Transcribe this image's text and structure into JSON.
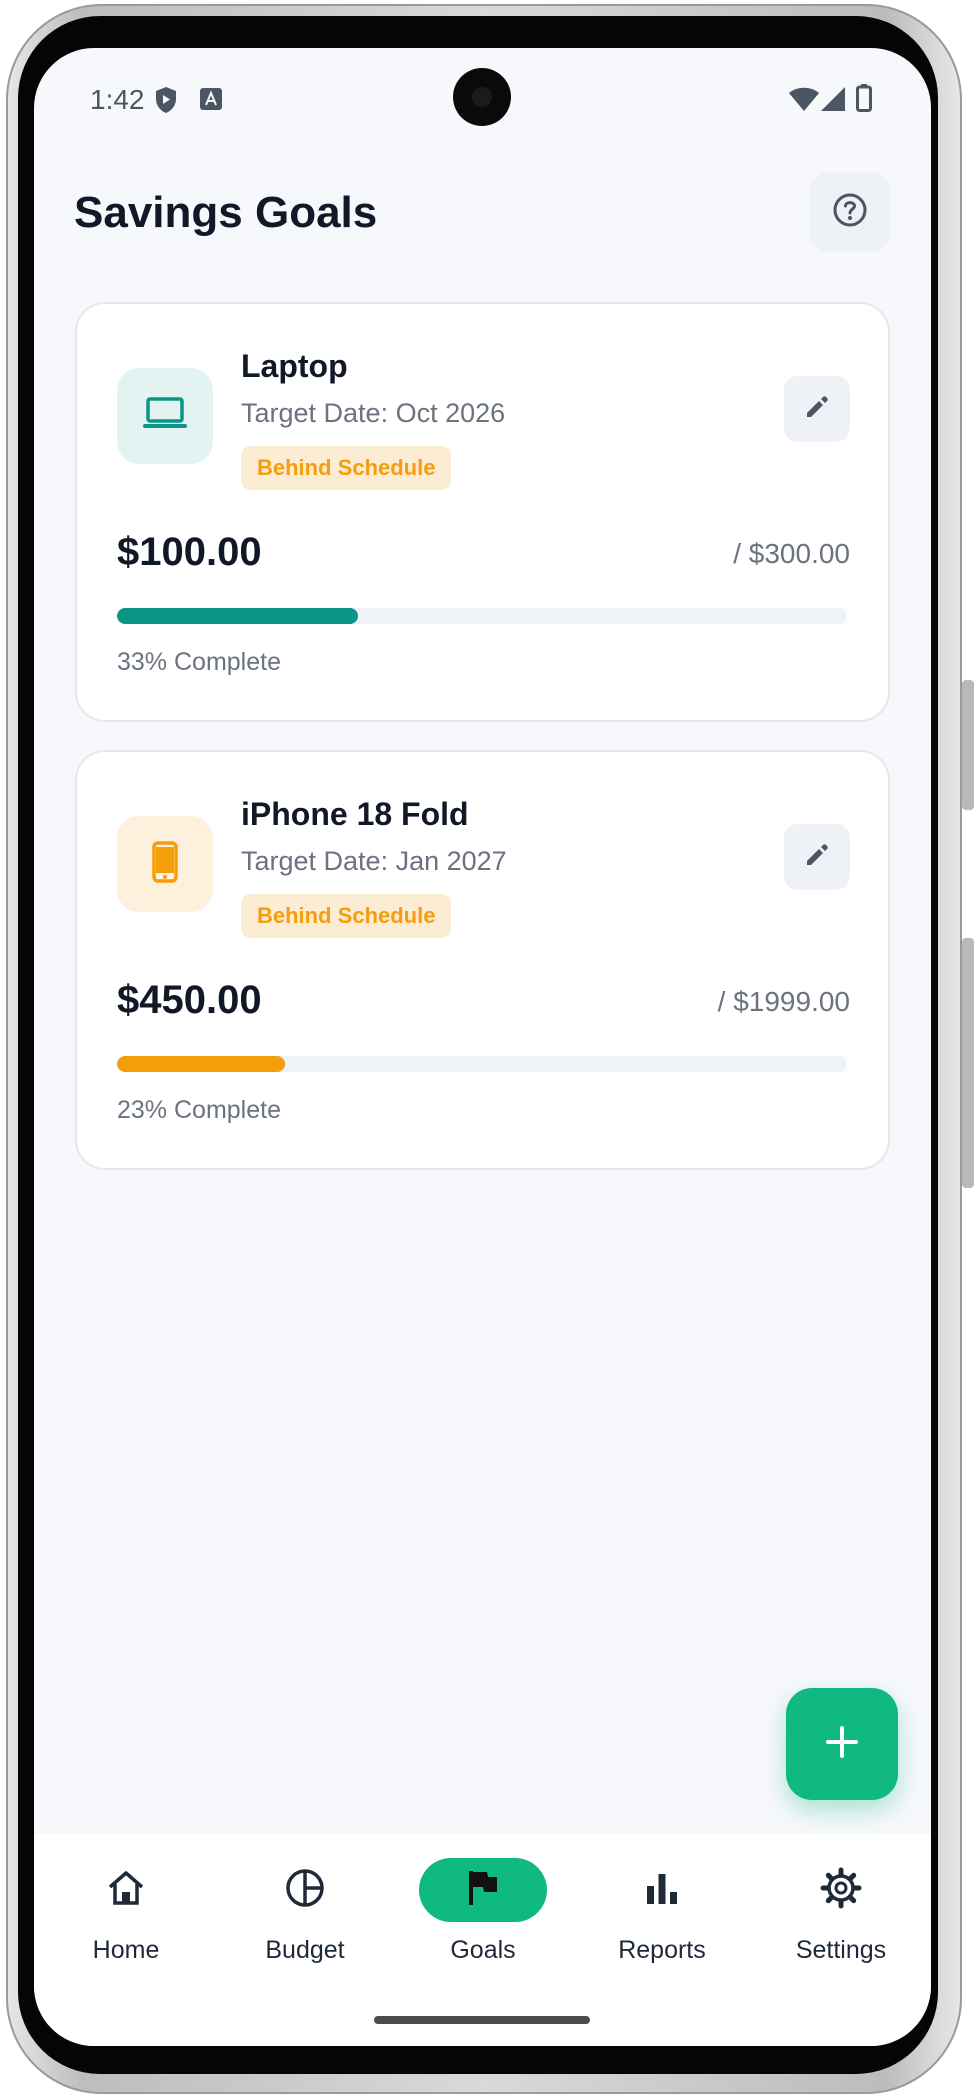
{
  "status_bar": {
    "time": "1:42"
  },
  "header": {
    "title": "Savings Goals"
  },
  "goals": [
    {
      "name": "Laptop",
      "target_date": "Target Date: Oct 2026",
      "status": "Behind Schedule",
      "saved": "$100.00",
      "target": "/ $300.00",
      "progress_fraction": 0.33,
      "progress_label": "33% Complete",
      "icon": "laptop-icon",
      "accent_color": "#0d9488",
      "icon_bg": "#e3f3f1"
    },
    {
      "name": "iPhone 18 Fold",
      "target_date": "Target Date: Jan 2027",
      "status": "Behind Schedule",
      "saved": "$450.00",
      "target": "/ $1999.00",
      "progress_fraction": 0.23,
      "progress_label": "23% Complete",
      "icon": "phone-icon",
      "accent_color": "#f59e0b",
      "icon_bg": "#fdf0dc"
    }
  ],
  "nav": {
    "items": [
      {
        "label": "Home",
        "icon": "home-icon"
      },
      {
        "label": "Budget",
        "icon": "pie-chart-icon"
      },
      {
        "label": "Goals",
        "icon": "flag-icon",
        "active": true
      },
      {
        "label": "Reports",
        "icon": "bar-chart-icon"
      },
      {
        "label": "Settings",
        "icon": "gear-icon"
      }
    ]
  },
  "colors": {
    "primary": "#10b981",
    "badge_text": "#f59e0b",
    "badge_bg": "#fdecd4"
  }
}
